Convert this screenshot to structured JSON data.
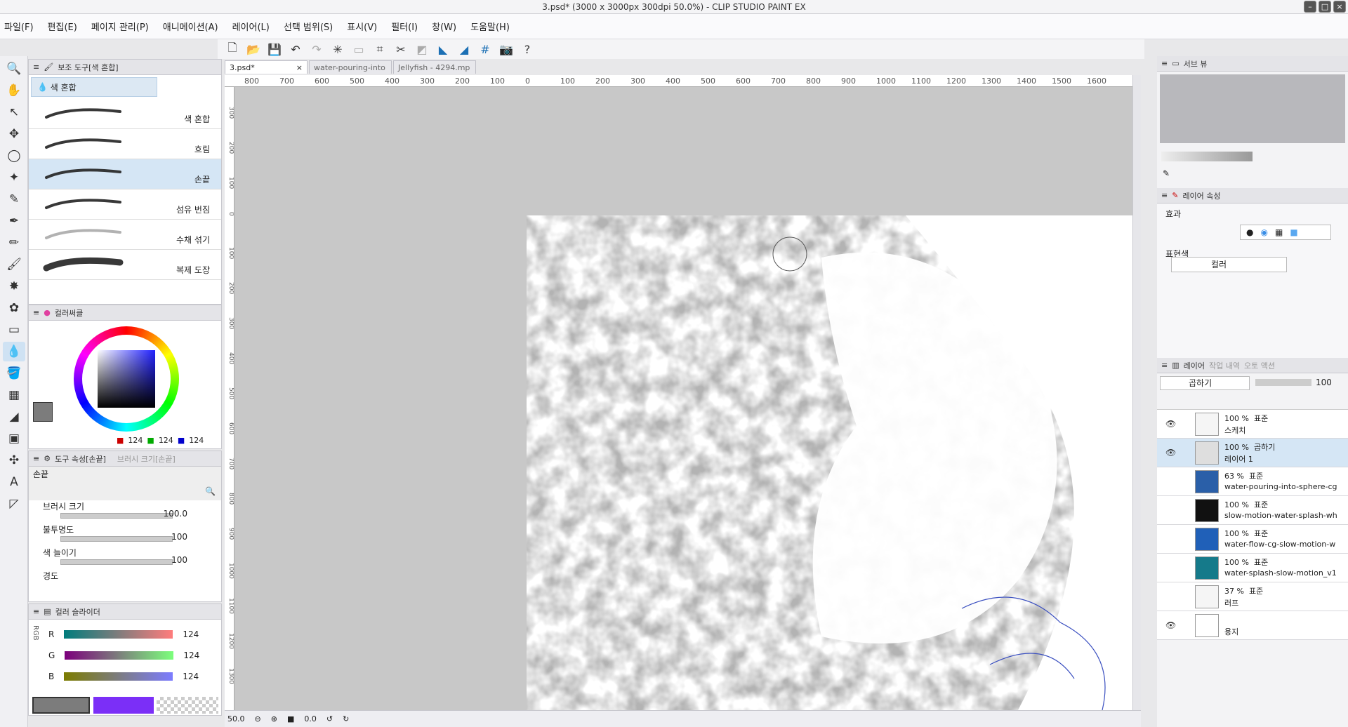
{
  "window": {
    "title": "3.psd* (3000 x 3000px 300dpi 50.0%) - CLIP STUDIO PAINT EX"
  },
  "menu": [
    "파일(F)",
    "편집(E)",
    "페이지 관리(P)",
    "애니메이션(A)",
    "레이어(L)",
    "선택 범위(S)",
    "표시(V)",
    "필터(I)",
    "창(W)",
    "도움말(H)"
  ],
  "subtool": {
    "panel_title": "보조 도구[색 혼합]",
    "group": "색 혼합",
    "brushes": [
      "색 혼합",
      "흐림",
      "손끝",
      "섬유 번짐",
      "수채 섞기",
      "복제 도장"
    ],
    "selected_index": 2
  },
  "color_circle": {
    "title": "컬러써클",
    "r": "124",
    "g": "124",
    "b": "124",
    "main_color": "#7c7c7c",
    "sub_color": "#7b2ff7"
  },
  "tool_property": {
    "title": "도구 속성[손끝]",
    "tab2": "브러시 크기[손끝]",
    "tool_name": "손끝",
    "size_label": "브러시 크기",
    "size_value": "100.0",
    "opacity_label": "불투명도",
    "opacity_value": "100",
    "stretch_label": "색 늘이기",
    "stretch_value": "100",
    "hardness_label": "경도"
  },
  "color_slider": {
    "title": "컬러 슬라이더",
    "mode": "RGB",
    "r_label": "R",
    "g_label": "G",
    "b_label": "B",
    "r": "124",
    "g": "124",
    "b": "124"
  },
  "tabs": [
    {
      "label": "3.psd*",
      "active": true
    },
    {
      "label": "water-pouring-into",
      "active": false
    },
    {
      "label": "Jellyfish - 4294.mp",
      "active": false
    }
  ],
  "ruler": {
    "h": [
      "800",
      "700",
      "600",
      "500",
      "400",
      "300",
      "200",
      "100",
      "0",
      "100",
      "200",
      "300",
      "400",
      "500",
      "600",
      "700",
      "800",
      "900",
      "1000",
      "1100",
      "1200",
      "1300",
      "1400",
      "1500",
      "1600"
    ],
    "v": [
      "300",
      "200",
      "100",
      "0",
      "100",
      "200",
      "300",
      "400",
      "500",
      "600",
      "700",
      "800",
      "900",
      "1000",
      "1100",
      "1200",
      "1300"
    ]
  },
  "status": {
    "zoom": "50.0",
    "rotation": "0.0"
  },
  "navigator": {
    "tab": "서브 뷰"
  },
  "layer_property": {
    "title": "레이어 속성",
    "effect_label": "효과",
    "express_label": "표현색",
    "express_value": "컬러"
  },
  "layers_panel": {
    "tab1": "레이어",
    "tab2": "작업 내역",
    "tab3": "오토 액션",
    "blend": "곱하기",
    "opacity": "100"
  },
  "layers": [
    {
      "pct": "100 %",
      "mode": "표준",
      "name": "스케치",
      "visible": true,
      "selected": false,
      "thumb": "#f5f5f5"
    },
    {
      "pct": "100 %",
      "mode": "곱하기",
      "name": "레이어 1",
      "visible": true,
      "selected": true,
      "thumb": "#dedede"
    },
    {
      "pct": "63 %",
      "mode": "표준",
      "name": "water-pouring-into-sphere-cg",
      "visible": false,
      "selected": false,
      "thumb": "#2a5fa8"
    },
    {
      "pct": "100 %",
      "mode": "표준",
      "name": "slow-motion-water-splash-wh",
      "visible": false,
      "selected": false,
      "thumb": "#111111"
    },
    {
      "pct": "100 %",
      "mode": "표준",
      "name": "water-flow-cg-slow-motion-w",
      "visible": false,
      "selected": false,
      "thumb": "#2060b8"
    },
    {
      "pct": "100 %",
      "mode": "표준",
      "name": "water-splash-slow-motion_v1",
      "visible": false,
      "selected": false,
      "thumb": "#157a8a"
    },
    {
      "pct": "37 %",
      "mode": "표준",
      "name": "러프",
      "visible": false,
      "selected": false,
      "thumb": "#f5f5f5"
    },
    {
      "pct": "",
      "mode": "",
      "name": "용지",
      "visible": true,
      "selected": false,
      "thumb": "#ffffff"
    }
  ]
}
